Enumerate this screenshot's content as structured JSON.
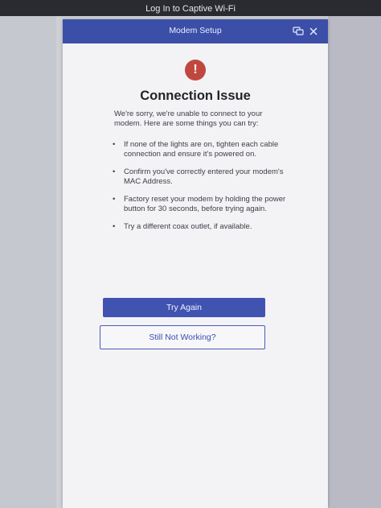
{
  "window": {
    "title": "Log In to Captive Wi-Fi"
  },
  "modal": {
    "header_title": "Modem Setup",
    "icons": {
      "chat": "chat-bubbles-icon",
      "close": "close-icon",
      "alert": "exclamation-alert-icon"
    },
    "alert_glyph": "!",
    "title": "Connection Issue",
    "intro": "We're sorry, we're unable to connect to your modem. Here are some things you can try:",
    "tips": [
      "If none of the lights are on, tighten each cable connection and ensure it's powered on.",
      "Confirm you've correctly entered your modem's MAC Address.",
      "Factory reset your modem by holding the power button for 30 seconds, before trying again.",
      "Try a different coax outlet, if available."
    ],
    "primary_button": "Try Again",
    "secondary_button": "Still Not Working?"
  },
  "colors": {
    "header_blue": "#3b4fa8",
    "button_blue": "#4153b1",
    "alert_red": "#c0473e"
  }
}
